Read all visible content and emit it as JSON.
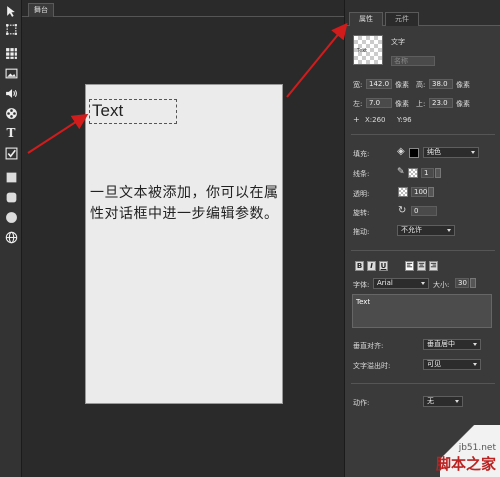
{
  "stage": {
    "tab": "舞台"
  },
  "canvas": {
    "text_box": "Text",
    "caption": "一旦文本被添加，你可以在属性对话框中进一步编辑参数。"
  },
  "panel": {
    "tabs": [
      "属性",
      "元件"
    ],
    "thumb_label": "Text",
    "type_label": "文字",
    "name_placeholder": "名称",
    "width_label": "宽:",
    "width_value": "142.0",
    "width_unit": "像素",
    "height_label": "高:",
    "height_value": "38.0",
    "height_unit": "像素",
    "left_label": "左:",
    "left_value": "7.0",
    "left_unit": "像素",
    "top_label": "上:",
    "top_value": "23.0",
    "top_unit": "像素",
    "coords_x": "X:260",
    "coords_y": "Y:96",
    "fill_label": "填充:",
    "fill_value": "纯色",
    "stroke_label": "线条:",
    "stroke_value": "1",
    "opacity_label": "透明:",
    "opacity_value": "100",
    "rotate_label": "旋转:",
    "rotate_value": "0",
    "drag_label": "拖动:",
    "drag_value": "不允许",
    "format_buttons": [
      "B",
      "I",
      "U"
    ],
    "font_label": "字体:",
    "font_value": "Arial",
    "size_label": "大小:",
    "size_value": "30",
    "text_value": "Text",
    "valign_label": "垂直对齐:",
    "valign_value": "垂直居中",
    "overflow_label": "文字溢出时:",
    "overflow_value": "可见",
    "action_label": "动作:",
    "action_value": "无"
  },
  "watermark": {
    "site": "jb51.net",
    "brand": "脚本之家"
  },
  "colors": {
    "arrow": "#d21c1c",
    "stage_bg": "#2a2a2a",
    "panel_bg": "#3a3a3a",
    "page_bg": "#ebebeb"
  }
}
